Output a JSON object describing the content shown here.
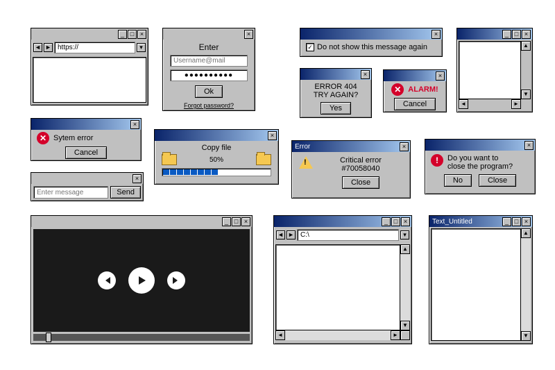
{
  "browser": {
    "url_value": "https://",
    "back": "◄",
    "fwd": "►"
  },
  "login": {
    "title": "Enter",
    "user_ph": "Username@mail",
    "pass_value": "●●●●●●●●●●",
    "ok": "Ok",
    "forgot": "Forgot password?"
  },
  "dontshow": {
    "text": "Do not show this message again"
  },
  "error404": {
    "line1": "ERROR 404",
    "line2": "TRY AGAIN?",
    "yes": "Yes"
  },
  "alarm": {
    "text": "ALARM!",
    "cancel": "Cancel"
  },
  "syserr": {
    "text": "Sytem error",
    "cancel": "Cancel"
  },
  "copy": {
    "title": "Copy file",
    "pct": "50%"
  },
  "critical": {
    "title": "Error",
    "line1": "Critical error",
    "line2": "#70058040",
    "close": "Close"
  },
  "closeprog": {
    "line1": "Do you want to",
    "line2": "close the program?",
    "no": "No",
    "close": "Close"
  },
  "sendmsg": {
    "ph": "Enter message",
    "send": "Send"
  },
  "explorer": {
    "path": "C:\\"
  },
  "notepad": {
    "title": "Text_Untitled"
  }
}
